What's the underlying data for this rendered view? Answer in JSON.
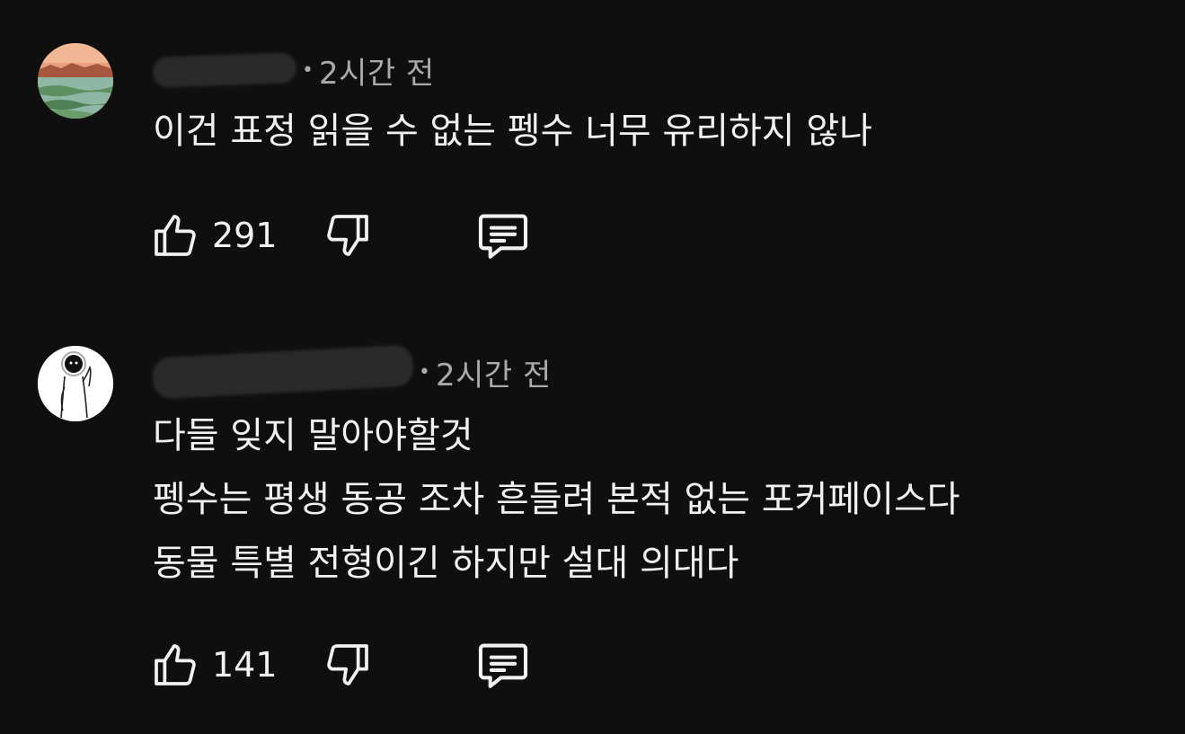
{
  "comments": [
    {
      "time_ago": "2시간 전",
      "lines": [
        "이건 표정 읽을 수 없는 펭수 너무 유리하지 않나"
      ],
      "like_count": "291",
      "icons": {
        "like": "thumbs-up-icon",
        "dislike": "thumbs-down-icon",
        "reply": "comment-reply-icon"
      }
    },
    {
      "time_ago": "2시간 전",
      "lines": [
        "다들 잊지 말아야할것",
        "펭수는 평생 동공 조차 흔들려 본적 없는 포커페이스다",
        "동물 특별 전형이긴 하지만 설대 의대다"
      ],
      "like_count": "141",
      "icons": {
        "like": "thumbs-up-icon",
        "dislike": "thumbs-down-icon",
        "reply": "comment-reply-icon"
      }
    }
  ],
  "colors": {
    "background": "#0f0f0f",
    "text_primary": "#f1f1f1",
    "text_secondary": "#aaaaaa"
  }
}
